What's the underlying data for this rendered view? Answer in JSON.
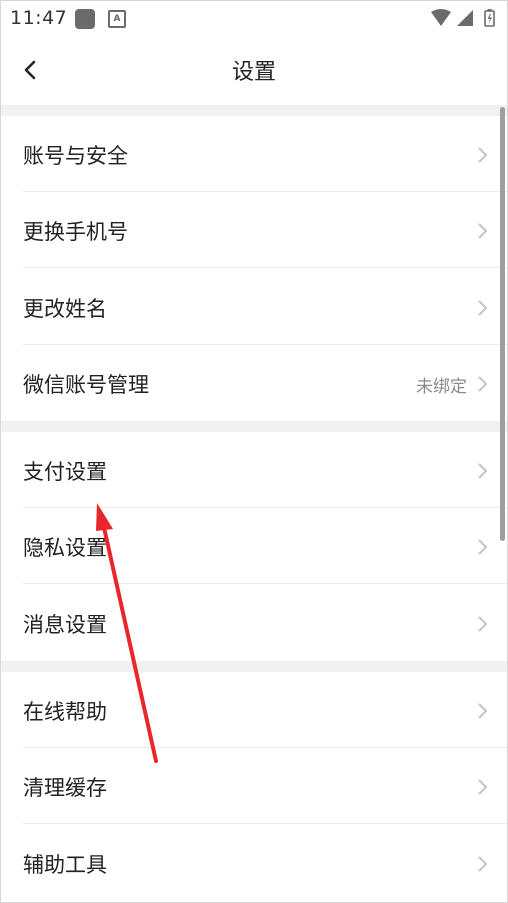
{
  "status_bar": {
    "time": "11:47",
    "a_icon_glyph": "A"
  },
  "header": {
    "title": "设置",
    "back_icon": "chevron-left-icon"
  },
  "sections": [
    {
      "items": [
        {
          "label": "账号与安全",
          "value": ""
        },
        {
          "label": "更换手机号",
          "value": ""
        },
        {
          "label": "更改姓名",
          "value": ""
        },
        {
          "label": "微信账号管理",
          "value": "未绑定"
        }
      ]
    },
    {
      "items": [
        {
          "label": "支付设置",
          "value": ""
        },
        {
          "label": "隐私设置",
          "value": ""
        },
        {
          "label": "消息设置",
          "value": ""
        }
      ]
    },
    {
      "items": [
        {
          "label": "在线帮助",
          "value": ""
        },
        {
          "label": "清理缓存",
          "value": ""
        },
        {
          "label": "辅助工具",
          "value": ""
        }
      ]
    }
  ],
  "colors": {
    "annotation_arrow": "#e8262b",
    "section_gap": "#f1f1f4",
    "chevron": "#c4c4c4"
  }
}
